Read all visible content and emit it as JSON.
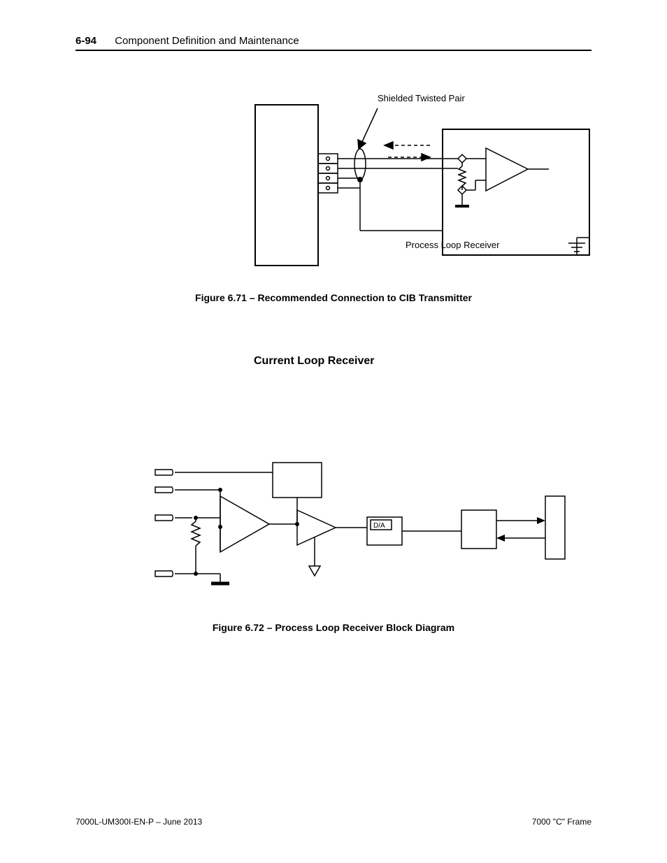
{
  "header": {
    "page_number": "6-94",
    "chapter_title": "Component Definition and Maintenance"
  },
  "diagram1": {
    "label_twisted_pair": "Shielded Twisted Pair",
    "label_receiver": "Process Loop Receiver",
    "caption": "Figure 6.71 – Recommended Connection to CIB Transmitter"
  },
  "section": {
    "title": "Current Loop Receiver"
  },
  "diagram2": {
    "block_label": "D/A",
    "caption": "Figure 6.72 – Process Loop Receiver Block Diagram"
  },
  "footer": {
    "left": "7000L-UM300I-EN-P – June 2013",
    "right": "7000 \"C\" Frame"
  }
}
